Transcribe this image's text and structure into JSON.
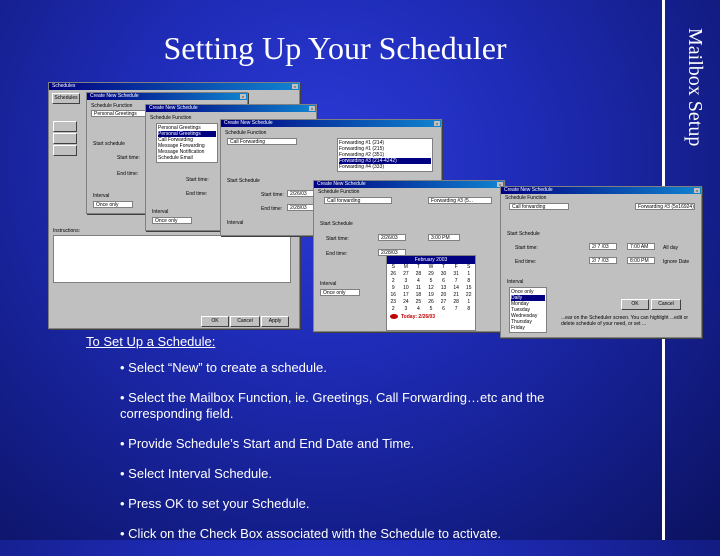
{
  "slide": {
    "title": "Setting Up Your Scheduler",
    "sidebar_label": "Mailbox Setup",
    "instructions_heading": "To Set Up a Schedule:",
    "bullets": [
      "• Select “New” to create a schedule.",
      "• Select the Mailbox Function, ie. Greetings, Call Forwarding…etc and the corresponding field.",
      "• Provide Schedule’s Start and End Date and Time.",
      "• Select Interval Schedule.",
      "• Press OK to set your Schedule.",
      "• Click on the Check Box associated with the Schedule to activate."
    ]
  },
  "screens": {
    "w1": {
      "title": "Schedules",
      "tab": "Schedules",
      "ok": "OK",
      "cancel": "Cancel",
      "apply": "Apply",
      "instructions_label": "Instructions:"
    },
    "w2": {
      "title": "Create New Schedule",
      "schedule_function_label": "Schedule Function",
      "function_value": "Personal Greetings",
      "start_schedule": "Start schedule",
      "start_time": "Start time:",
      "end_time": "End time:",
      "interval": "Interval",
      "interval_value": "Once only"
    },
    "w3": {
      "title": "Create New Schedule",
      "schedule_function_label": "Schedule Function",
      "function_value": "Personal Greetings",
      "options": [
        "Personal Greetings",
        "Personal Greetings",
        "Call Forwarding",
        "Message Forwarding",
        "Message Notification",
        "Schedule Email"
      ],
      "start_time": "Start time:",
      "end_time": "End time:",
      "interval": "Interval",
      "interval_value": "Once only"
    },
    "w4": {
      "title": "Create New Schedule",
      "schedule_function_label": "Schedule Function",
      "function_value": "Call Forwarding",
      "fwd_options": [
        "Forwarding #1  (214)",
        "Forwarding #1  (215)",
        "Forwarding #2  (351)",
        "Forwarding #3  (214-4242)",
        "Forwarding #4  (333)"
      ],
      "start_schedule": "Start Schedule",
      "start_time": "Start time:",
      "end_time": "End time:",
      "start_date": "2/26/03",
      "end_date": "2/28/03",
      "interval": "Interval",
      "interval_value": "Once only"
    },
    "w5": {
      "title": "Create New Schedule",
      "schedule_function_label": "Schedule Function",
      "function_value": "Call forwarding",
      "fwd_value": "Forwarding #3 (5...",
      "start_schedule": "Start Schedule",
      "start_time": "Start time:",
      "end_time": "End time:",
      "start_date": "2/26/03",
      "start_clock": "3:00 PM",
      "end_date": "2/28/03",
      "interval": "Interval",
      "interval_value": "Once only",
      "calendar": {
        "month": "February 2003",
        "days": [
          "Sun",
          "Mon",
          "Tue",
          "Wed",
          "Thu",
          "Fri",
          "Sat"
        ],
        "dates": [
          "26",
          "27",
          "28",
          "29",
          "30",
          "31",
          "1",
          "2",
          "3",
          "4",
          "5",
          "6",
          "7",
          "8",
          "9",
          "10",
          "11",
          "12",
          "13",
          "14",
          "15",
          "16",
          "17",
          "18",
          "19",
          "20",
          "21",
          "22",
          "23",
          "24",
          "25",
          "26",
          "27",
          "28",
          "1",
          "2",
          "3",
          "4",
          "5",
          "6",
          "7",
          "8"
        ],
        "today": "Today: 2/26/03"
      }
    },
    "w6": {
      "title": "Create New Schedule",
      "schedule_function_label": "Schedule Function",
      "function_value": "Call forwarding",
      "fwd_value": "Forwarding #3 (5x16924)",
      "start_schedule": "Start Schedule",
      "start_time": "Start time:",
      "end_time": "End time:",
      "start_date": "2/ 7 /03",
      "start_clock": "7:00 AM",
      "end_date": "2/ 7 /03",
      "end_clock": "8:00 PM",
      "all_day": "All day",
      "ignore_date": "Ignore Date",
      "interval": "Interval",
      "interval_value": "Once only",
      "interval_options": [
        "Once only",
        "Daily",
        "Monday",
        "Tuesday",
        "Wednesday",
        "Thursday",
        "Friday",
        "Saturday",
        "Sunday"
      ],
      "ok": "OK",
      "cancel": "Cancel",
      "note": "...ear on the Scheduler screen. You can highlight ...edit or delete schedule of your need, or set ..."
    }
  }
}
